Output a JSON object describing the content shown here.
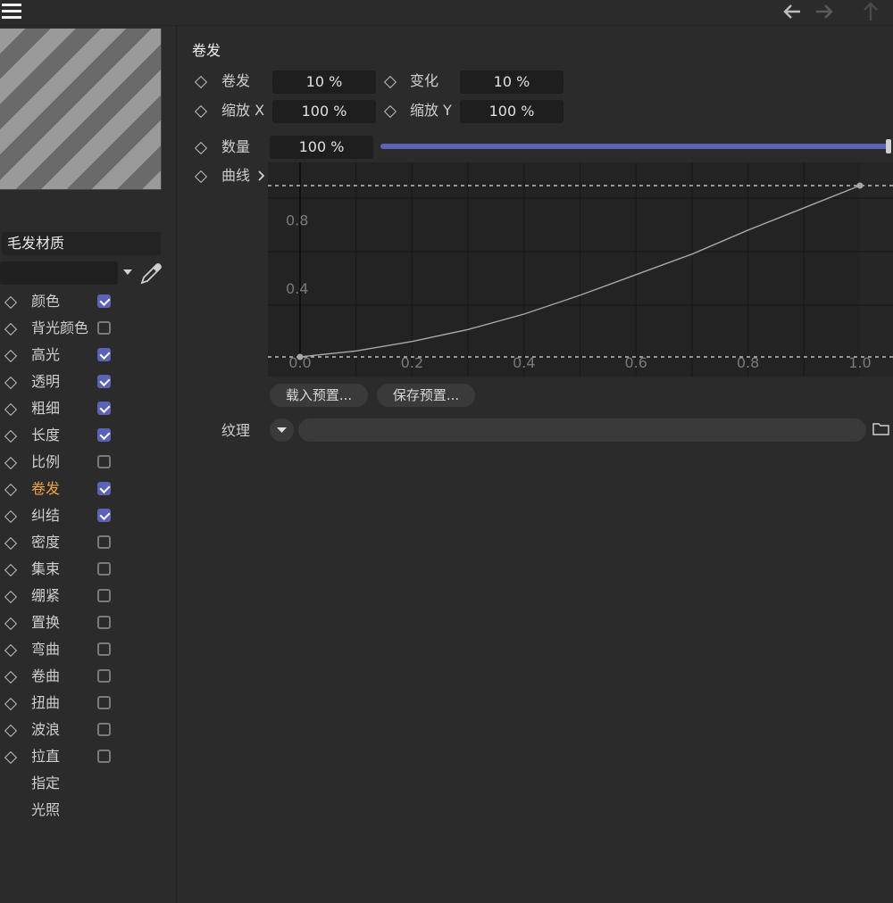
{
  "header": {
    "menu_icon": "hamburger-icon",
    "back_icon": "arrow-left-icon",
    "forward_icon": "arrow-right-icon",
    "up_icon": "arrow-up-icon"
  },
  "sidebar": {
    "material_name": "毛发材质",
    "eyedropper_icon": "eyedropper-icon",
    "channels": [
      {
        "label": "颜色",
        "checked": true,
        "keyframe": true,
        "active": false
      },
      {
        "label": "背光颜色",
        "checked": false,
        "keyframe": true,
        "active": false
      },
      {
        "label": "高光",
        "checked": true,
        "keyframe": true,
        "active": false
      },
      {
        "label": "透明",
        "checked": true,
        "keyframe": true,
        "active": false
      },
      {
        "label": "粗细",
        "checked": true,
        "keyframe": true,
        "active": false
      },
      {
        "label": "长度",
        "checked": true,
        "keyframe": true,
        "active": false
      },
      {
        "label": "比例",
        "checked": false,
        "keyframe": true,
        "active": false
      },
      {
        "label": "卷发",
        "checked": true,
        "keyframe": true,
        "active": true
      },
      {
        "label": "纠结",
        "checked": true,
        "keyframe": true,
        "active": false
      },
      {
        "label": "密度",
        "checked": false,
        "keyframe": true,
        "active": false
      },
      {
        "label": "集束",
        "checked": false,
        "keyframe": true,
        "active": false
      },
      {
        "label": "绷紧",
        "checked": false,
        "keyframe": true,
        "active": false
      },
      {
        "label": "置换",
        "checked": false,
        "keyframe": true,
        "active": false
      },
      {
        "label": "弯曲",
        "checked": false,
        "keyframe": true,
        "active": false
      },
      {
        "label": "卷曲",
        "checked": false,
        "keyframe": true,
        "active": false
      },
      {
        "label": "扭曲",
        "checked": false,
        "keyframe": true,
        "active": false
      },
      {
        "label": "波浪",
        "checked": false,
        "keyframe": true,
        "active": false
      },
      {
        "label": "拉直",
        "checked": false,
        "keyframe": true,
        "active": false
      },
      {
        "label": "指定",
        "checked": null,
        "keyframe": false,
        "active": false
      },
      {
        "label": "光照",
        "checked": null,
        "keyframe": false,
        "active": false
      }
    ]
  },
  "panel": {
    "title": "卷发",
    "curl_label": "卷发",
    "curl_value": "10 %",
    "variation_label": "变化",
    "variation_value": "10 %",
    "scale_x_label": "缩放 X",
    "scale_x_value": "100 %",
    "scale_y_label": "缩放 Y",
    "scale_y_value": "100 %",
    "amount_label": "数量",
    "amount_value": "100 %",
    "amount_fraction": 1.0,
    "curve_label": "曲线",
    "curve_expand_icon": "chevron-right-icon",
    "load_preset": "载入预置...",
    "save_preset": "保存预置...",
    "texture_label": "纹理",
    "texture_dropdown_icon": "chevron-down-icon",
    "folder_icon": "folder-icon",
    "accent_color": "#5b63b6"
  },
  "chart_data": {
    "type": "line",
    "x_ticks": [
      "0.0",
      "0.2",
      "0.4",
      "0.6",
      "0.8",
      "1.0"
    ],
    "y_ticks": [
      "0.4",
      "0.8"
    ],
    "xlim": [
      0,
      1
    ],
    "ylim": [
      0,
      1
    ],
    "grid": true,
    "points": [
      [
        0.0,
        0.0
      ],
      [
        1.0,
        1.0
      ]
    ],
    "curve": [
      [
        0,
        0
      ],
      [
        0.1,
        0.035
      ],
      [
        0.2,
        0.09
      ],
      [
        0.3,
        0.16
      ],
      [
        0.4,
        0.25
      ],
      [
        0.5,
        0.36
      ],
      [
        0.6,
        0.48
      ],
      [
        0.7,
        0.6
      ],
      [
        0.8,
        0.74
      ],
      [
        0.9,
        0.87
      ],
      [
        1.0,
        1.0
      ]
    ]
  }
}
